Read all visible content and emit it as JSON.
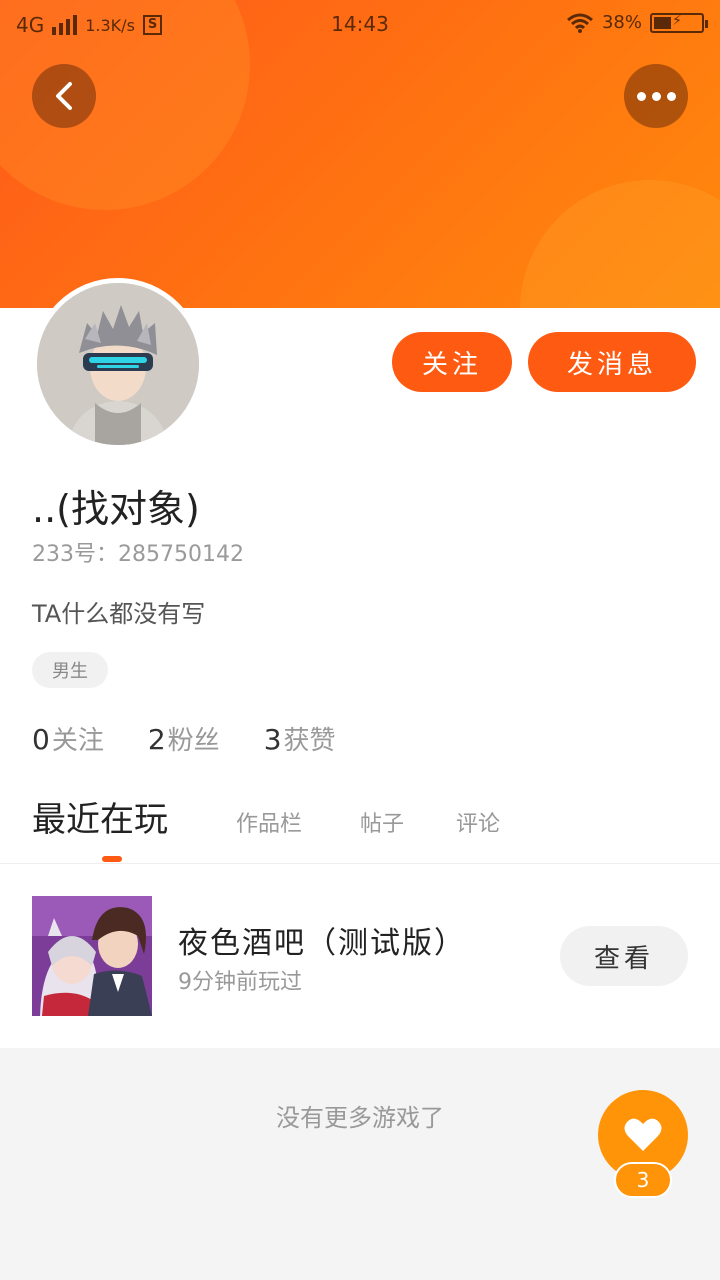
{
  "status_bar": {
    "network": "4G",
    "speed": "1.3K/s",
    "s_badge": "S",
    "time": "14:43",
    "battery_percent": "38%",
    "battery_level": 0.38
  },
  "header": {
    "back_icon": "chevron-left-icon",
    "more_icon": "more-dots-icon"
  },
  "actions": {
    "follow_label": "关注",
    "message_label": "发消息"
  },
  "profile": {
    "nickname": "..(找对象)",
    "uid_line": "233号：285750142",
    "bio": "TA什么都没有写",
    "gender": "男生"
  },
  "stats": [
    {
      "num": "0",
      "label": "关注"
    },
    {
      "num": "2",
      "label": "粉丝"
    },
    {
      "num": "3",
      "label": "获赞"
    }
  ],
  "tabs": [
    {
      "label": "最近在玩",
      "active": true
    },
    {
      "label": "作品栏",
      "active": false
    },
    {
      "label": "帖子",
      "active": false
    },
    {
      "label": "评论",
      "active": false
    }
  ],
  "recent_game": {
    "title": "夜色酒吧（测试版）",
    "subtitle": "9分钟前玩过",
    "view_label": "查看"
  },
  "footer": {
    "no_more": "没有更多游戏了"
  },
  "like": {
    "icon": "heart-icon",
    "count": "3"
  },
  "colors": {
    "accent": "#ff5a12",
    "like": "#ff9408",
    "header_start": "#ff5a1a",
    "header_end": "#ff8a0c"
  }
}
